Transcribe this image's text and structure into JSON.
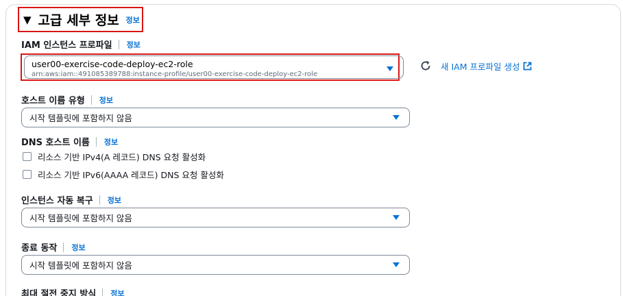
{
  "section": {
    "title": "고급 세부 정보",
    "info": "정보"
  },
  "iam": {
    "label": "IAM 인스턴스 프로파일",
    "info": "정보",
    "value": "user00-exercise-code-deploy-ec2-role",
    "arn": "arn:aws:iam::491085389788:instance-profile/user00-exercise-code-deploy-ec2-role",
    "create_link": "새 IAM 프로파일 생성"
  },
  "hostname_type": {
    "label": "호스트 이름 유형",
    "info": "정보",
    "value": "시작 템플릿에 포함하지 않음"
  },
  "dns_hostname": {
    "label": "DNS 호스트 이름",
    "info": "정보",
    "options": [
      {
        "label": "리소스 기반 IPv4(A 레코드) DNS 요청 활성화",
        "checked": false
      },
      {
        "label": "리소스 기반 IPv6(AAAA 레코드) DNS 요청 활성화",
        "checked": false
      }
    ]
  },
  "auto_recovery": {
    "label": "인스턴스 자동 복구",
    "info": "정보",
    "value": "시작 템플릿에 포함하지 않음"
  },
  "shutdown_behavior": {
    "label": "종료 동작",
    "info": "정보",
    "value": "시작 템플릿에 포함하지 않음"
  },
  "stop_hibernate": {
    "label": "최대 절전 중지 방식",
    "info": "정보"
  },
  "colors": {
    "link": "#0972d3",
    "highlight": "#d91515",
    "border": "#7d8998"
  }
}
